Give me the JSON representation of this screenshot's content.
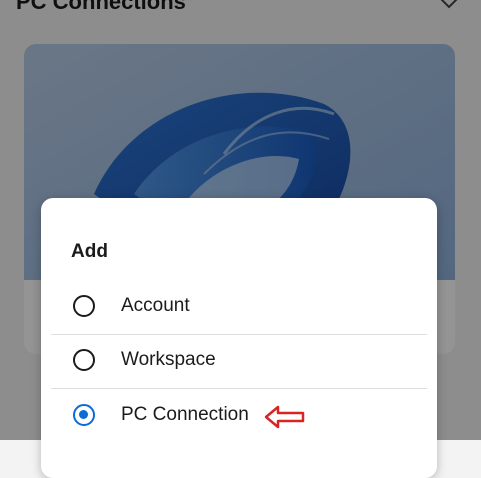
{
  "header": {
    "title": "PC Connections"
  },
  "dialog": {
    "title": "Add",
    "options": [
      {
        "label": "Account",
        "selected": false
      },
      {
        "label": "Workspace",
        "selected": false
      },
      {
        "label": "PC Connection",
        "selected": true
      }
    ]
  },
  "colors": {
    "accent": "#0a6cd6",
    "annotation": "#d92424"
  },
  "icons": {
    "header_chevron": "chevron-down-icon",
    "annotation": "arrow-left-outline-icon"
  }
}
